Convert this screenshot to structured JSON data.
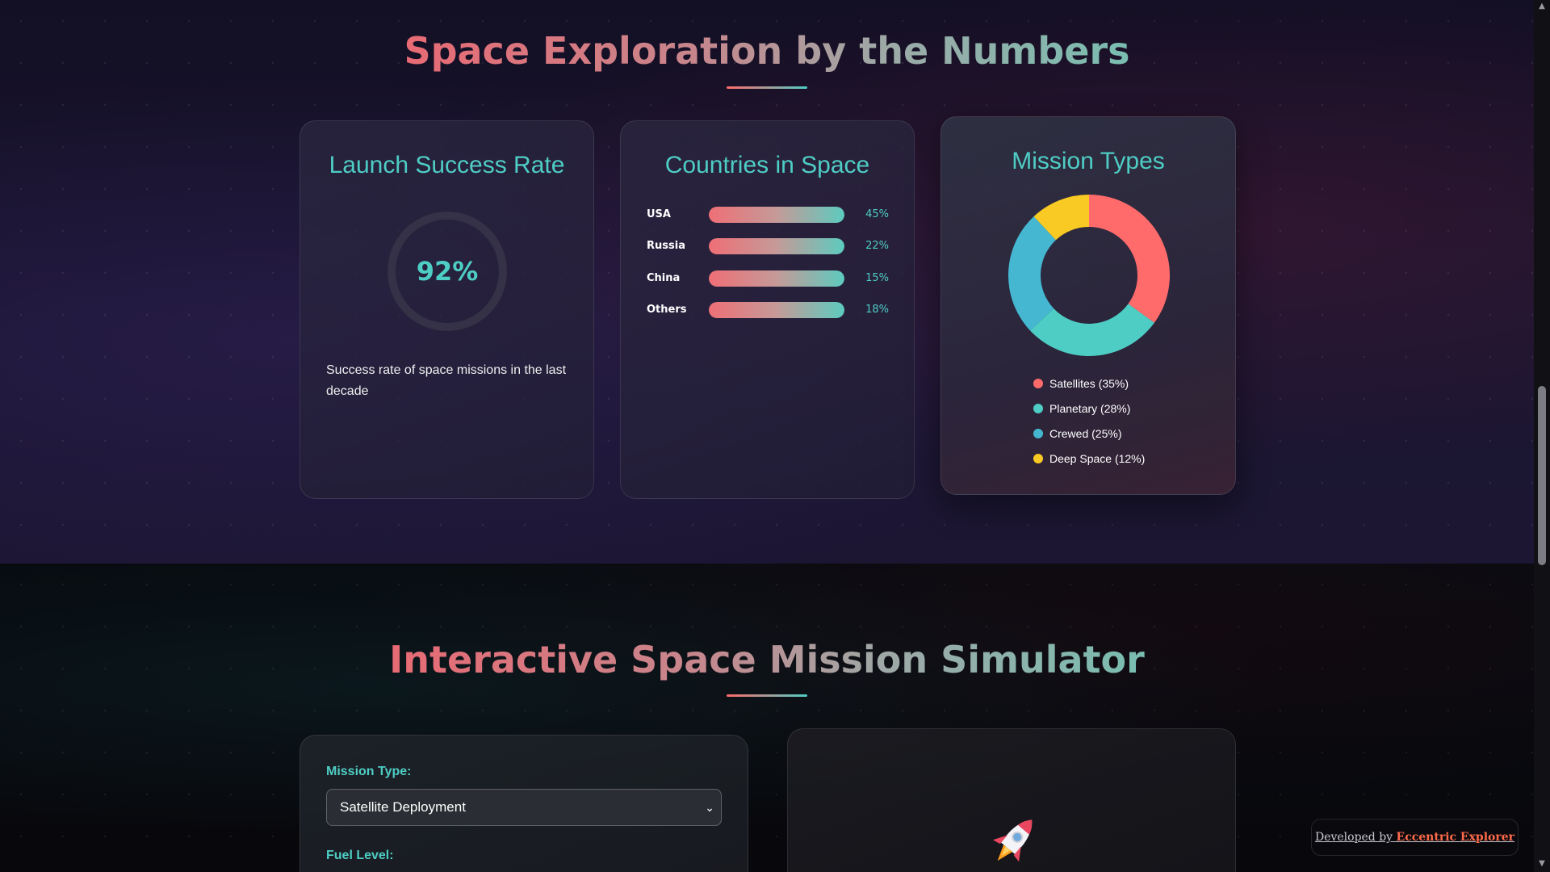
{
  "stats_section": {
    "title": "Space Exploration by the Numbers",
    "launch_card": {
      "title": "Launch Success Rate",
      "value": "92%",
      "description": "Success rate of space missions in the last decade"
    },
    "countries_card": {
      "title": "Countries in Space",
      "rows": [
        {
          "label": "USA",
          "percent": "45%"
        },
        {
          "label": "Russia",
          "percent": "22%"
        },
        {
          "label": "China",
          "percent": "15%"
        },
        {
          "label": "Others",
          "percent": "18%"
        }
      ]
    },
    "mission_types_card": {
      "title": "Mission Types",
      "legend": [
        {
          "label": "Satellites (35%)",
          "color": "#ff6b6b"
        },
        {
          "label": "Planetary (28%)",
          "color": "#4ecdc4"
        },
        {
          "label": "Crewed (25%)",
          "color": "#45b7d1"
        },
        {
          "label": "Deep Space (12%)",
          "color": "#f9ca24"
        }
      ]
    }
  },
  "chart_data": {
    "type": "pie",
    "categories": [
      "Satellites",
      "Planetary",
      "Crewed",
      "Deep Space"
    ],
    "values": [
      35,
      28,
      25,
      12
    ],
    "colors": [
      "#ff6b6b",
      "#4ecdc4",
      "#45b7d1",
      "#f9ca24"
    ],
    "donut": true
  },
  "simulator_section": {
    "title": "Interactive Space Mission Simulator",
    "mission_type_label": "Mission Type:",
    "mission_type_value": "Satellite Deployment",
    "fuel_label": "Fuel Level:",
    "rocket_icon": "rocket-icon"
  },
  "footer_credit": {
    "prefix": "Developed by",
    "brand": "Eccentric Explorer"
  },
  "colors": {
    "accent_teal": "#4ecdc4",
    "accent_coral": "#ff6b6b"
  }
}
